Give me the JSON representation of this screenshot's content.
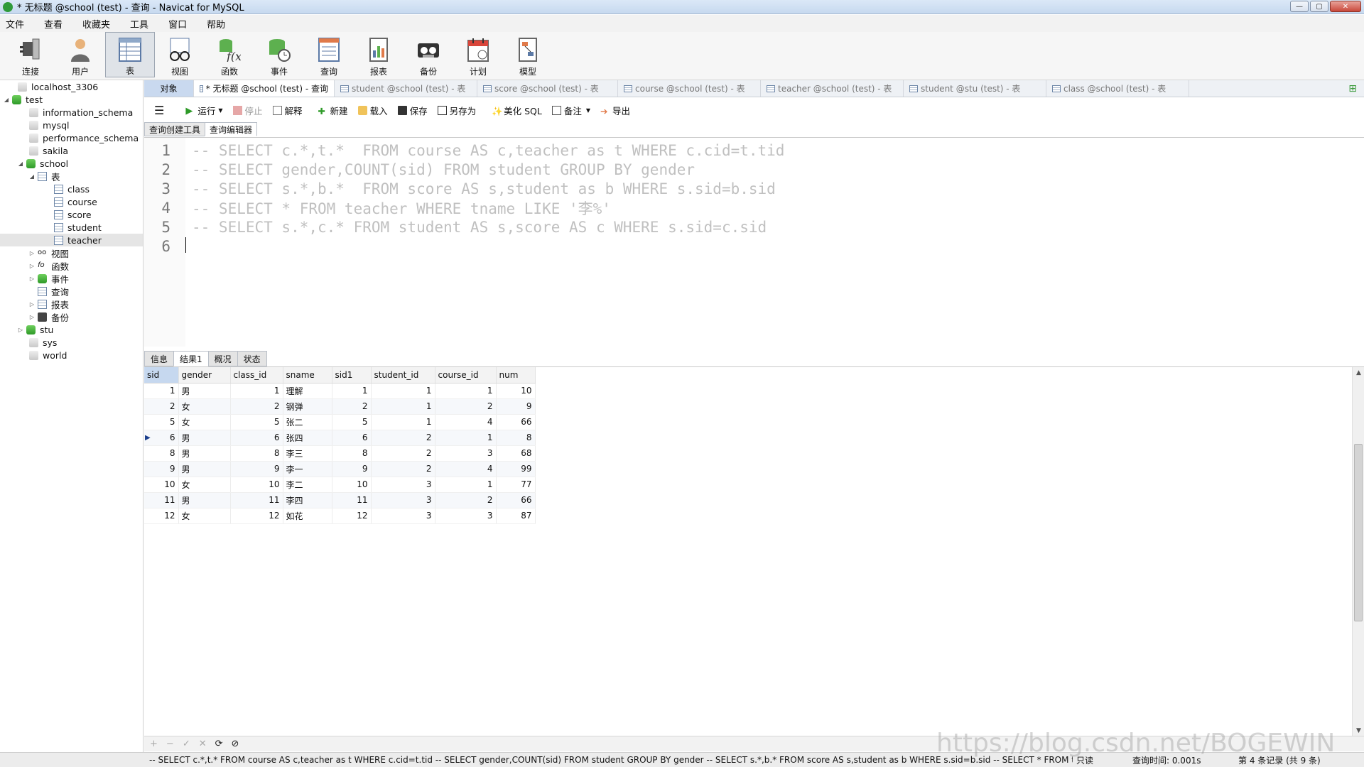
{
  "window": {
    "title": "* 无标题 @school (test) - 查询 - Navicat for MySQL"
  },
  "menu": [
    "文件",
    "查看",
    "收藏夹",
    "工具",
    "窗口",
    "帮助"
  ],
  "toolbar": [
    "连接",
    "用户",
    "表",
    "视图",
    "函数",
    "事件",
    "查询",
    "报表",
    "备份",
    "计划",
    "模型"
  ],
  "tree": {
    "connection": "localhost_3306",
    "test": "test",
    "dbs_top": [
      "information_schema",
      "mysql",
      "performance_schema",
      "sakila"
    ],
    "school": "school",
    "tables_node": "表",
    "tables": [
      "class",
      "course",
      "score",
      "student",
      "teacher"
    ],
    "school_nodes": [
      "视图",
      "函数",
      "事件",
      "查询",
      "报表",
      "备份"
    ],
    "dbs_bottom": [
      "stu",
      "sys",
      "world"
    ]
  },
  "tabs": {
    "objects": "对象",
    "current": "* 无标题 @school (test) - 查询",
    "others": [
      "student @school (test) - 表",
      "score @school (test) - 表",
      "course @school (test) - 表",
      "teacher @school (test) - 表",
      "student @stu (test) - 表",
      "class @school (test) - 表"
    ]
  },
  "query_toolbar": {
    "run": "运行",
    "stop": "停止",
    "explain": "解释",
    "new": "新建",
    "load": "载入",
    "save": "保存",
    "save_as": "另存为",
    "beautify": "美化 SQL",
    "comment": "备注",
    "export": "导出"
  },
  "editor_tabs": [
    "查询创建工具",
    "查询编辑器"
  ],
  "code_lines": [
    "-- SELECT c.*,t.*  FROM course AS c,teacher as t WHERE c.cid=t.tid",
    "-- SELECT gender,COUNT(sid) FROM student GROUP BY gender",
    "-- SELECT s.*,b.*  FROM score AS s,student as b WHERE s.sid=b.sid",
    "-- SELECT * FROM teacher WHERE tname LIKE '李%'",
    "-- SELECT s.*,c.* FROM student AS s,score AS c WHERE s.sid=c.sid",
    ""
  ],
  "result_tabs": [
    "信息",
    "结果1",
    "概况",
    "状态"
  ],
  "grid": {
    "columns": [
      "sid",
      "gender",
      "class_id",
      "sname",
      "sid1",
      "student_id",
      "course_id",
      "num"
    ],
    "rows": [
      [
        "1",
        "男",
        "1",
        "理解",
        "1",
        "1",
        "1",
        "10"
      ],
      [
        "2",
        "女",
        "2",
        "钢弹",
        "2",
        "1",
        "2",
        "9"
      ],
      [
        "5",
        "女",
        "5",
        "张二",
        "5",
        "1",
        "4",
        "66"
      ],
      [
        "6",
        "男",
        "6",
        "张四",
        "6",
        "2",
        "1",
        "8"
      ],
      [
        "8",
        "男",
        "8",
        "李三",
        "8",
        "2",
        "3",
        "68"
      ],
      [
        "9",
        "男",
        "9",
        "李一",
        "9",
        "2",
        "4",
        "99"
      ],
      [
        "10",
        "女",
        "10",
        "李二",
        "10",
        "3",
        "1",
        "77"
      ],
      [
        "11",
        "男",
        "11",
        "李四",
        "11",
        "3",
        "2",
        "66"
      ],
      [
        "12",
        "女",
        "12",
        "如花",
        "12",
        "3",
        "3",
        "87"
      ]
    ],
    "current_row": 3
  },
  "bottom_controls": [
    "+",
    "−",
    "✓",
    "✕",
    "⟳",
    "⊘"
  ],
  "status": {
    "sql": "-- SELECT c.*,t.*  FROM course AS c,teacher as t WHERE c.cid=t.tid -- SELECT gender,COUNT(sid) FROM student GROUP BY gender -- SELECT s.*,b.*  FROM score AS s,student as b WHERE s.sid=b.sid -- SELECT * FROM teaci",
    "readonly": "只读",
    "time": "查询时间: 0.001s",
    "records": "第 4 条记录 (共 9 条)"
  },
  "watermark": "https://blog.csdn.net/BOGEWIN"
}
